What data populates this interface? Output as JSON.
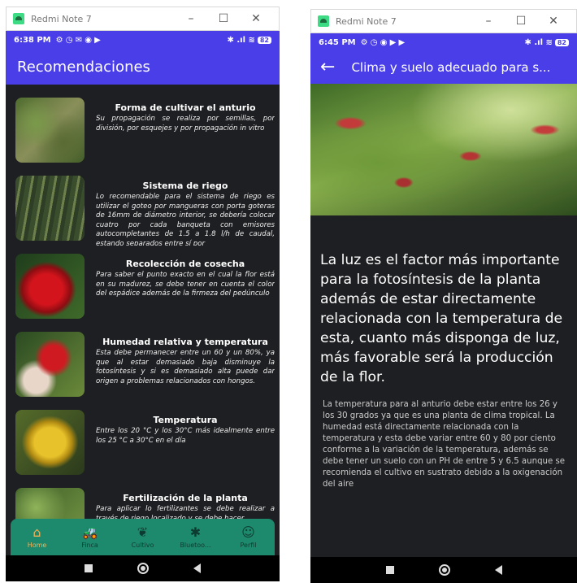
{
  "device_title": "Redmi Note 7",
  "screen1": {
    "status_time": "6:38 PM",
    "status_icons": "⚙ ◷ ✉ ◉ ▶",
    "status_right": "✱ .ıl ≋",
    "battery": "82",
    "title": "Recomendaciones",
    "items": [
      {
        "title": "Forma de cultivar el anturio",
        "desc": "Su propagación se realiza por semillas, por división, por esquejes y por propagación in vitro"
      },
      {
        "title": "Sistema de riego",
        "desc": "Lo recomendable para el sistema de riego es utilizar el goteo por mangueras con porta goteras de 16mm de diámetro interior, se debería colocar cuatro por cada banqueta con emisores autocompletantes de 1.5 a 1.8 l/h de caudal, estando separados entre sí por"
      },
      {
        "title": "Recolección de cosecha",
        "desc": "Para saber el punto exacto en el cual la flor está en su madurez, se debe tener en cuenta el color del espádice además de la firmeza del pedúnculo"
      },
      {
        "title": "Humedad relativa y temperatura",
        "desc": "Esta debe permanecer entre un 60 y un 80%, ya que al estar demasiado baja disminuye la fotosíntesis y si es demasiado alta puede dar origen a problemas relacionados con hongos."
      },
      {
        "title": "Temperatura",
        "desc": "Entre los 20 °C y los 30°C más idealmente entre los 25 °C a 30°C en el día"
      },
      {
        "title": "Fertilización de la planta",
        "desc": "Para aplicar lo fertilizantes se debe realizar a través de riego localizado y se debe hacer"
      }
    ],
    "nav": [
      {
        "label": "Home",
        "icon": "⌂"
      },
      {
        "label": "Finca",
        "icon": "🚜"
      },
      {
        "label": "Cultivo",
        "icon": "❦"
      },
      {
        "label": "Bluetoo...",
        "icon": "✱"
      },
      {
        "label": "Perfil",
        "icon": "☺"
      }
    ],
    "active_nav": "Home"
  },
  "screen2": {
    "status_time": "6:45 PM",
    "status_icons": "⚙ ◷ ◉ ▶ ▶",
    "status_right": "✱ .ıl ≋",
    "battery": "82",
    "title": "Clima y suelo adecuado para s...",
    "lead": "La luz es el factor más importante para la fotosíntesis de la planta además de estar directamente relacionada con la temperatura de esta, cuanto más disponga de luz, más favorable será la producción de la flor.",
    "body": "La temperatura para al anturio debe estar entre los 26 y los 30 grados ya que es una planta de clima tropical. La humedad está directamente relacionada con la temperatura y esta debe variar entre 60 y 80 por ciento conforme a la variación de la temperatura, además se debe tener un suelo con un PH de entre 5 y 6.5 aunque se recomienda el cultivo en sustrato debido a la oxigenación del aire"
  },
  "colors": {
    "accent": "#4a3ee8",
    "nav_bg": "#1d8a6d",
    "nav_active": "#f2b25a",
    "bg": "#1e1f22"
  }
}
